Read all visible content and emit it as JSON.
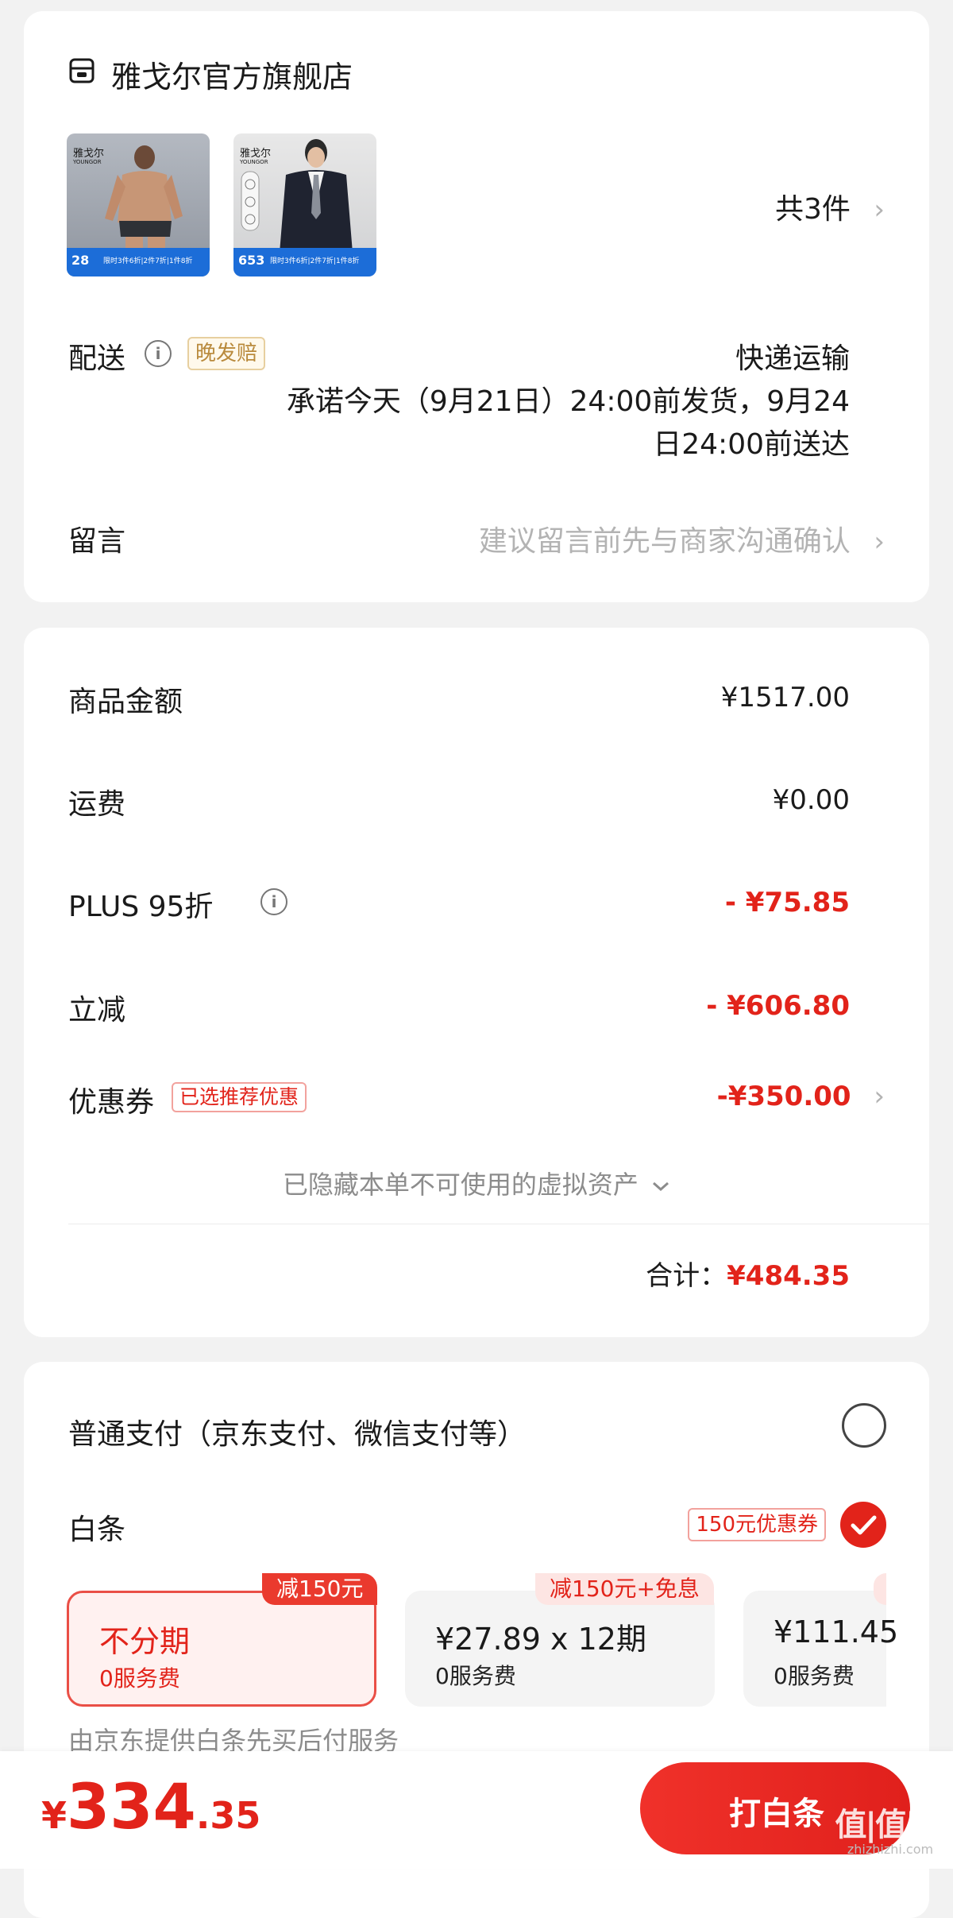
{
  "store": {
    "icon": "store-icon",
    "name": "雅戈尔官方旗舰店",
    "items_count": "共3件",
    "chevron": "›"
  },
  "products": [
    {
      "brand": "雅戈尔",
      "brand_en": "YOUNGOR",
      "price": "28",
      "promo": "限时3件6折|2件7折|1件8折"
    },
    {
      "brand": "雅戈尔",
      "brand_en": "YOUNGOR",
      "price": "653",
      "promo": "限时3件6折|2件7折|1件8折"
    }
  ],
  "delivery": {
    "label": "配送",
    "tag": "晚发赔",
    "method": "快递运输",
    "promise_line1": "承诺今天（9月21日）24:00前发货，9月24",
    "promise_line2": "日24:00前送达"
  },
  "message": {
    "label": "留言",
    "placeholder": "建议留言前先与商家沟通确认",
    "chevron": "›"
  },
  "price": {
    "goods": {
      "label": "商品金额",
      "value": "¥1517.00"
    },
    "shipping": {
      "label": "运费",
      "value": "¥0.00"
    },
    "plus": {
      "label": "PLUS 95折",
      "value": "- ¥75.85"
    },
    "instant": {
      "label": "立减",
      "value": "- ¥606.80"
    },
    "coupon": {
      "label": "优惠券",
      "tag": "已选推荐优惠",
      "value": "-¥350.00",
      "chevron": "›"
    },
    "hidden_assets": "已隐藏本单不可使用的虚拟资产",
    "total_label": "合计：",
    "total_value": "¥484.35"
  },
  "payment": {
    "normal_label": "普通支付（京东支付、微信支付等）",
    "baitiao_label": "白条",
    "baitiao_tag": "150元优惠券",
    "plans": [
      {
        "badge": "减150元",
        "main": "不分期",
        "sub": "0服务费",
        "selected": true
      },
      {
        "badge": "减150元+免息",
        "main": "¥27.89 x 12期",
        "sub": "0服务费",
        "selected": false
      },
      {
        "badge": "",
        "main": "¥111.45",
        "sub": "0服务费",
        "selected": false
      }
    ],
    "provider_note": "由京东提供白条先买后付服务"
  },
  "footer": {
    "currency": "¥",
    "amount_int": "334",
    "amount_dec": ".35",
    "button": "打白条",
    "watermark": "值|值|值",
    "watermark_sub": "zhizhizhi.com"
  },
  "colors": {
    "accent": "#e2231a",
    "gold": "#b98a3c",
    "background": "#f2f2f2"
  }
}
